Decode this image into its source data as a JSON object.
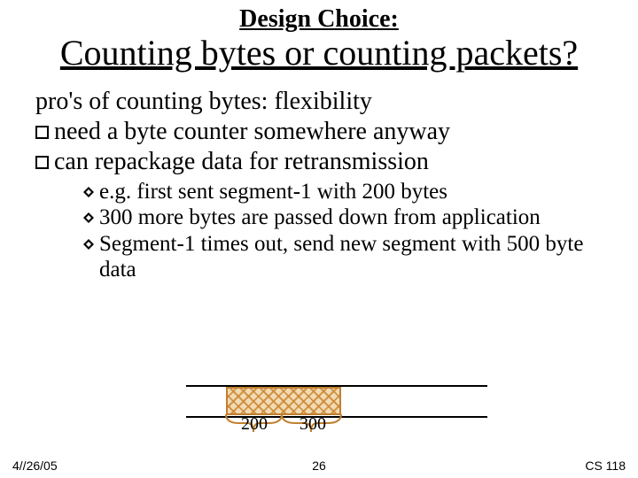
{
  "title": {
    "line1": "Design Choice:",
    "line2": "Counting bytes or counting packets?"
  },
  "body": {
    "lead": "pro's of counting bytes: flexibility",
    "bullets": [
      "need a byte counter somewhere anyway",
      "can repackage data for retransmission"
    ],
    "sub": [
      "e.g. first sent segment-1 with 200 bytes",
      "300 more bytes are passed down from application",
      "Segment-1 times out, send new segment with 500 byte data"
    ]
  },
  "diagram": {
    "seg1_label": "200",
    "seg2_label": "300"
  },
  "footer": {
    "date": "4//26/05",
    "page": "26",
    "course": "CS 118"
  }
}
